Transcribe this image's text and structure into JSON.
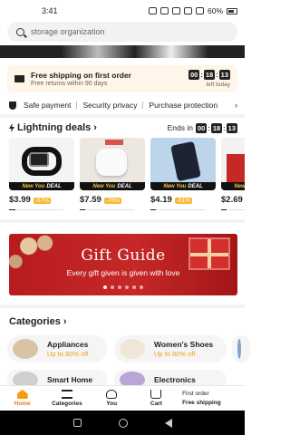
{
  "status_bar": {
    "time": "3:41",
    "battery": "60%"
  },
  "search": {
    "placeholder": "storage organization"
  },
  "shipping_banner": {
    "title": "Free shipping on first order",
    "subtitle": "Free returns within 90 days",
    "timer": [
      "00",
      "18",
      "13"
    ],
    "timer_label": "left today"
  },
  "trust_row": {
    "items": [
      "Safe payment",
      "Security privacy",
      "Purchase protection"
    ]
  },
  "deals": {
    "title": "Lightning deals",
    "ends_label": "Ends in",
    "timer": [
      "00",
      "18",
      "13"
    ],
    "tag_brand": "New You",
    "tag_deal": "DEAL",
    "items": [
      {
        "price": "$3.99",
        "off": "-57%",
        "sold_fraction": 0.12
      },
      {
        "price": "$7.59",
        "off": "-76%",
        "sold_fraction": 0.1
      },
      {
        "price": "$4.19",
        "off": "-61%",
        "sold_fraction": 0.1
      },
      {
        "price": "$2.69",
        "off": "",
        "sold_fraction": 0.1
      }
    ]
  },
  "gift_banner": {
    "title": "Gift Guide",
    "subtitle": "Every gift given is given with love",
    "slides": 6,
    "active_slide": 0
  },
  "categories": {
    "title": "Categories",
    "items": [
      {
        "name": "Appliances",
        "offer": "Up to 80% off"
      },
      {
        "name": "Women's Shoes",
        "offer": "Up to 80% off"
      },
      {
        "name": "Smart Home",
        "offer": ""
      },
      {
        "name": "Electronics",
        "offer": ""
      }
    ]
  },
  "bottom_nav": {
    "home": "Home",
    "categories": "Categories",
    "you": "You",
    "cart": "Cart",
    "free_line1": "First order",
    "free_line2": "Free shipping"
  }
}
